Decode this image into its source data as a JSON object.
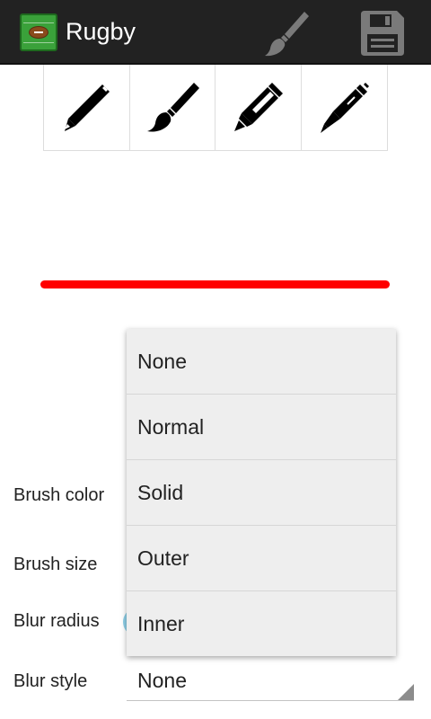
{
  "actionbar": {
    "title": "Rugby",
    "app_icon": "rugby-ball-icon",
    "actions": [
      {
        "icon": "brush-icon"
      },
      {
        "icon": "save-icon"
      }
    ],
    "background": "#222222"
  },
  "tools": [
    {
      "icon": "pencil-icon"
    },
    {
      "icon": "brush-icon"
    },
    {
      "icon": "marker-icon"
    },
    {
      "icon": "pen-icon"
    }
  ],
  "preview": {
    "color": "#ff0000"
  },
  "settings": {
    "brush_color_label": "Brush color",
    "brush_size_label": "Brush size",
    "blur_radius_label": "Blur radius",
    "blur_style_label": "Blur style",
    "blur_style_value": "None"
  },
  "dropdown": {
    "options": [
      "None",
      "Normal",
      "Solid",
      "Outer",
      "Inner"
    ]
  }
}
